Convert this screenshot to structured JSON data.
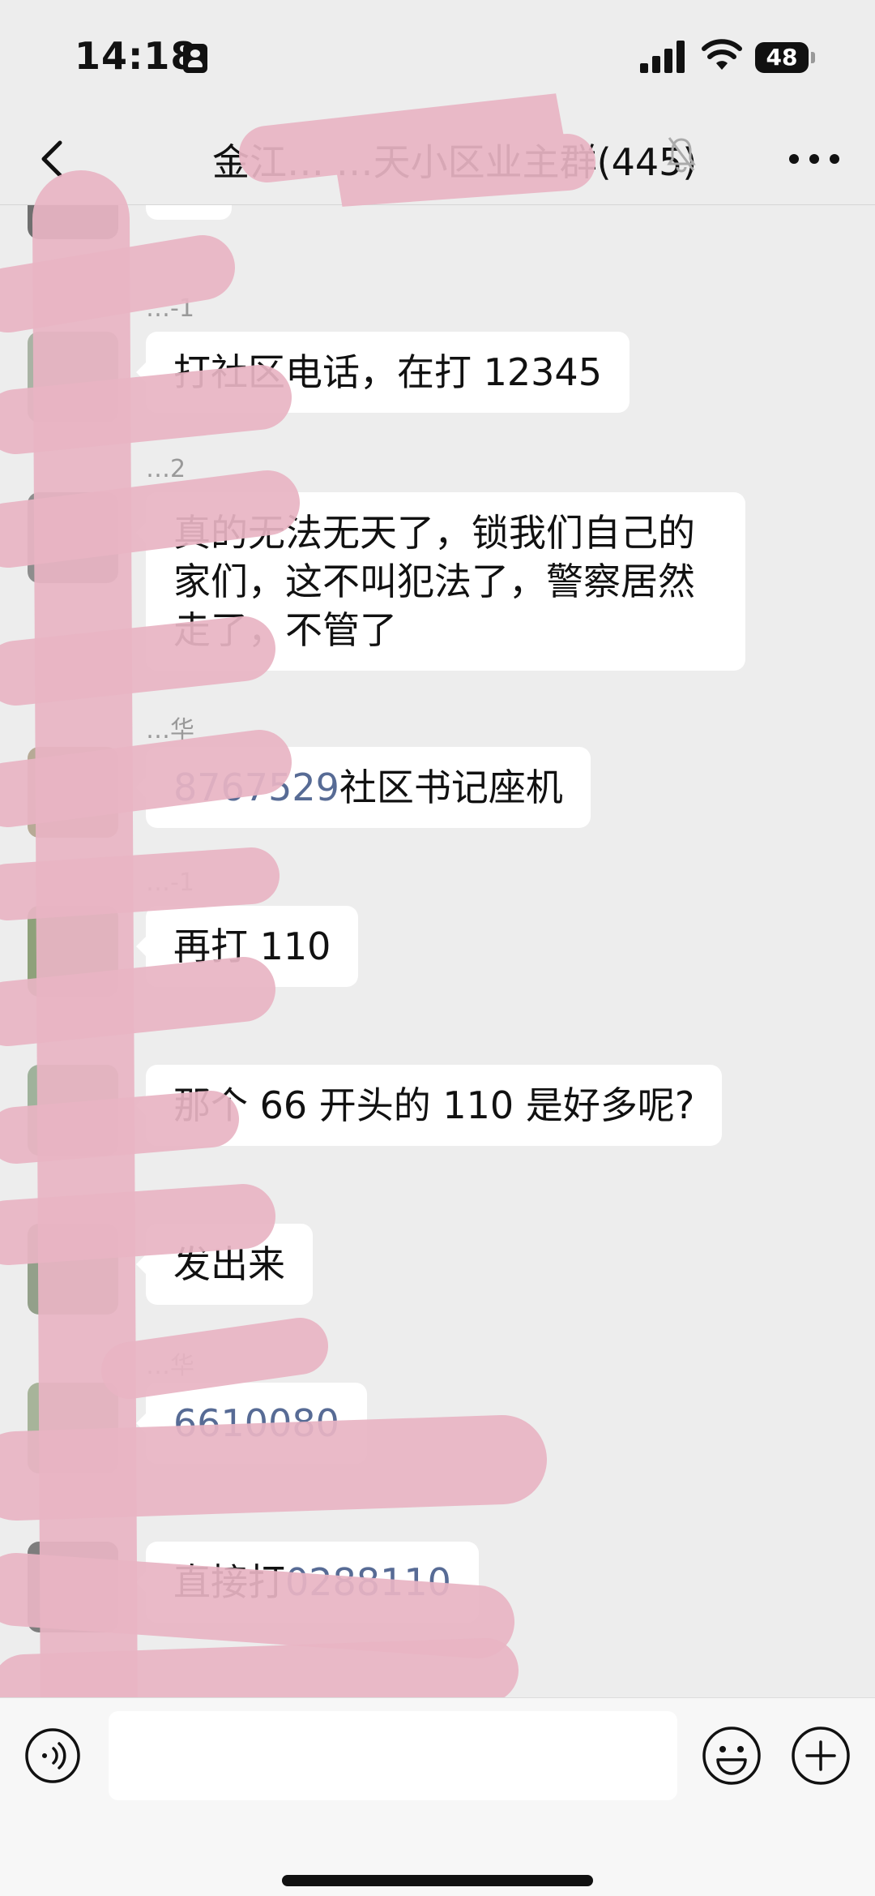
{
  "status_bar": {
    "time": "14:18",
    "battery": "48",
    "icons": [
      "id-card-icon",
      "signal-icon",
      "wifi-icon",
      "battery-icon"
    ]
  },
  "header": {
    "title": "金江… …天小区业主群(445)",
    "icons": [
      "back-icon",
      "mute-bell-icon",
      "more-icon"
    ]
  },
  "messages": [
    {
      "sender": "",
      "text": "😭"
    },
    {
      "sender": "…-1",
      "text": "打社区电话，在打 12345"
    },
    {
      "sender": "…2",
      "text": "真的无法无天了，锁我们自己的家们，这不叫犯法了，警察居然走了，不管了"
    },
    {
      "sender": "…华",
      "link": "8767529",
      "text": "社区书记座机"
    },
    {
      "sender": "…-1",
      "text": "再打 110"
    },
    {
      "sender": "",
      "text": "那个 66 开头的 110 是好多呢?"
    },
    {
      "sender": "",
      "text": "发出来"
    },
    {
      "sender": "…华",
      "link": "6610080",
      "text": ""
    },
    {
      "sender": "",
      "prefix": "直接打",
      "link": "0288110"
    }
  ],
  "colors": {
    "background": "#ededed",
    "bubble": "#ffffff",
    "link": "#576b95",
    "redaction": "#e8b4c3"
  },
  "input_bar": {
    "icons": [
      "voice-icon",
      "emoji-icon",
      "plus-icon"
    ]
  }
}
